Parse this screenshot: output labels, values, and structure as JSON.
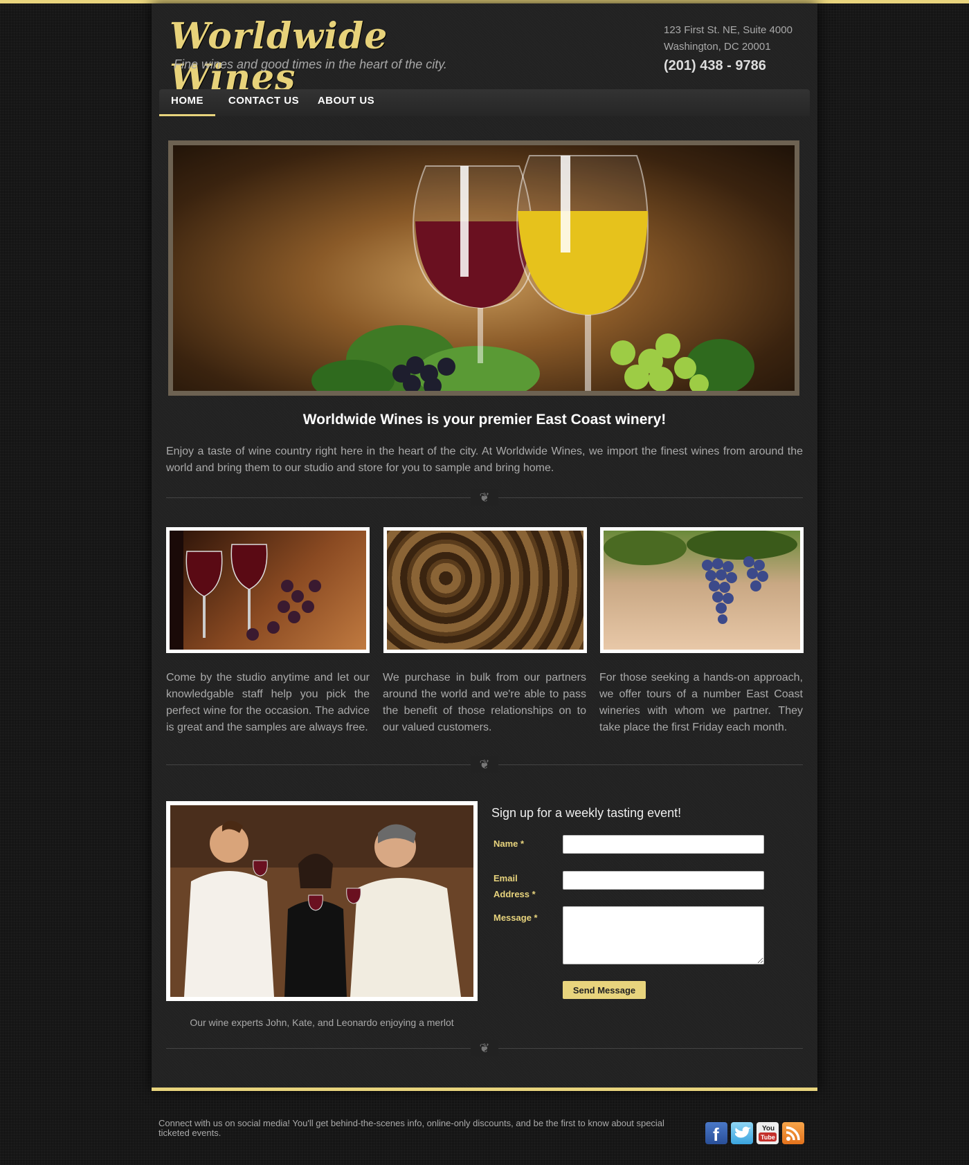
{
  "brand": {
    "name": "Worldwide Wines",
    "tagline": "Fine wines and good times in the heart of the city."
  },
  "contact": {
    "address_line1": "123 First St. NE, Suite 4000",
    "address_line2": "Washington, DC 20001",
    "phone": "(201) 438 - 9786"
  },
  "nav": {
    "items": [
      {
        "label": "HOME",
        "active": true
      },
      {
        "label": "CONTACT US",
        "active": false
      },
      {
        "label": "ABOUT US",
        "active": false
      }
    ]
  },
  "main": {
    "headline": "Worldwide Wines is your premier East Coast winery!",
    "intro": "Enjoy a taste of wine country right here in the heart of the city. At Worldwide Wines, we import the finest wines from around the world and bring them to our studio and store for you to sample and bring home.",
    "features": [
      {
        "image": "red-wine-glasses-grapes",
        "text": "Come by the studio anytime and let our knowledgable staff help you pick the perfect wine for the occasion. The advice is great and the samples are always free."
      },
      {
        "image": "wine-barrels",
        "text": "We purchase in bulk from our partners around the world and we're able to pass the benefit of those relationships on to our valued customers."
      },
      {
        "image": "grape-vine",
        "text": "For those seeking a hands-on approach, we offer tours of a number East Coast wineries with whom we partner. They take place the first Friday each month."
      }
    ],
    "photo_caption": "Our wine experts John, Kate, and Leonardo enjoying a merlot"
  },
  "form": {
    "title": "Sign up for a weekly tasting event!",
    "name_label": "Name *",
    "email_label_1": "Email",
    "email_label_2": "Address *",
    "message_label": "Message *",
    "name_value": "",
    "email_value": "",
    "message_value": "",
    "submit_label": "Send Message"
  },
  "footer": {
    "text": "Connect with us on social media! You'll get behind-the-scenes info, online-only discounts, and be the first to know about special ticketed events.",
    "social": [
      "facebook-icon",
      "twitter-icon",
      "youtube-icon",
      "rss-icon"
    ],
    "youtube_label_top": "You",
    "youtube_label_bottom": "Tube"
  },
  "colors": {
    "accent": "#e8d47d",
    "background": "#151515",
    "panel": "#222222",
    "text": "#aaaaaa"
  }
}
